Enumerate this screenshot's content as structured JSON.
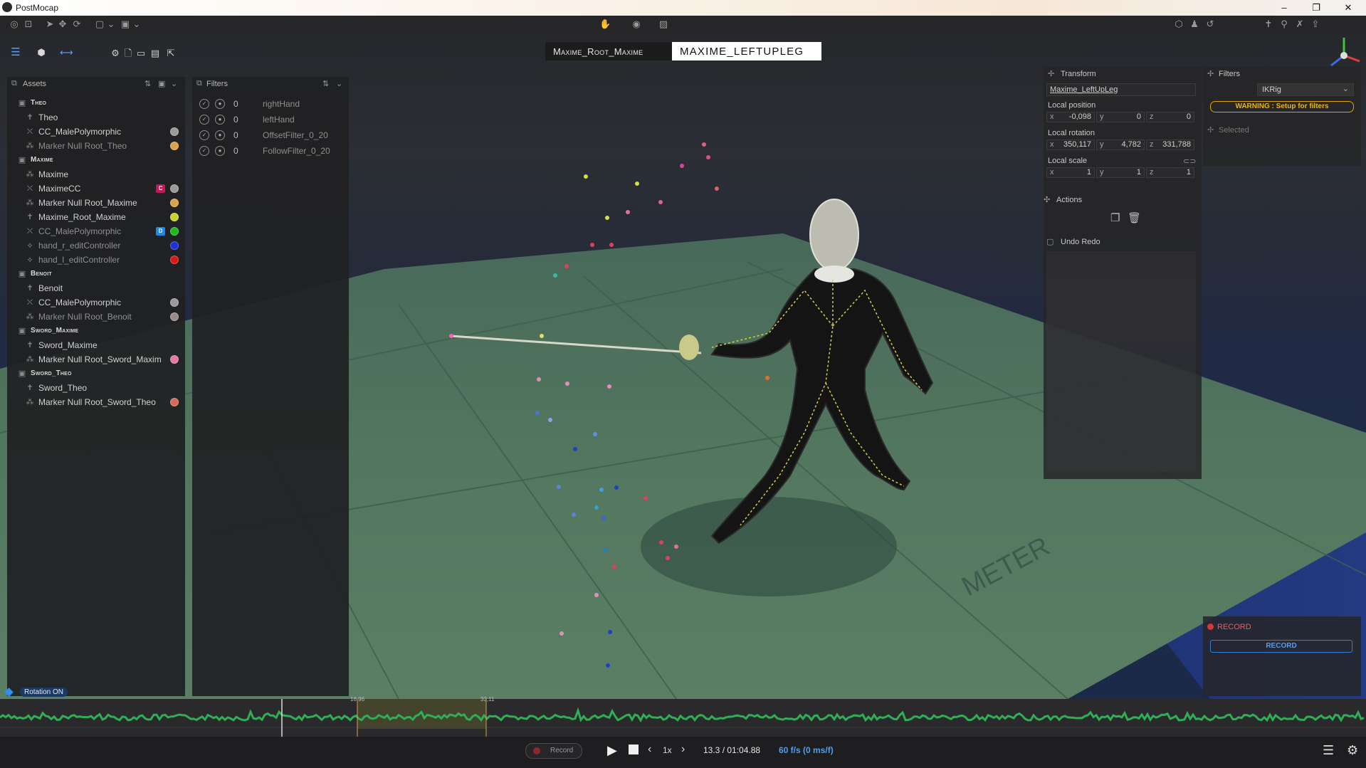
{
  "app": {
    "title": "PostMocap"
  },
  "window": {
    "minimize": "–",
    "restore": "❐",
    "close": "✕"
  },
  "toolbar": {
    "icons": [
      "select-icon",
      "move-icon",
      "rotate-icon",
      "frame-icon",
      "layout-icon",
      "hand-icon",
      "eye-icon",
      "image-icon",
      "paint-icon",
      "figure-icon",
      "undo-icon"
    ]
  },
  "tabs": [
    {
      "label": "Maxime_Root_Maxime",
      "active": false
    },
    {
      "label": "MAXIME_LEFTUPLEG",
      "active": true
    }
  ],
  "assets": {
    "header": "Assets",
    "groups": [
      {
        "name": "Theo",
        "items": [
          {
            "label": "Theo",
            "icon": "skeleton-icon",
            "dim": false
          },
          {
            "label": "CC_MalePolymorphic",
            "icon": "mesh-icon",
            "dot": "#9a9a9a",
            "dim": false
          },
          {
            "label": "Marker Null Root_Theo",
            "icon": "markers-icon",
            "dot": "#d9a34a",
            "dim": true
          }
        ]
      },
      {
        "name": "Maxime",
        "items": [
          {
            "label": "Maxime",
            "icon": "markers-icon",
            "dim": false
          },
          {
            "label": "MaximeCC",
            "icon": "mesh-icon",
            "badge": "C",
            "badge_color": "#c2185b",
            "dot": "#9a9a9a",
            "dim": false
          },
          {
            "label": "Marker Null Root_Maxime",
            "icon": "markers-icon",
            "dot": "#d9a34a",
            "dim": false
          },
          {
            "label": "Maxime_Root_Maxime",
            "icon": "skeleton-icon",
            "dot": "#c6d32e",
            "dim": false
          },
          {
            "label": "CC_MalePolymorphic",
            "icon": "mesh-icon",
            "badge": "D",
            "badge_color": "#1e88e5",
            "dot": "#21b521",
            "dim": true
          },
          {
            "label": "hand_r_editController",
            "icon": "controller-icon",
            "dot": "#1a33d6",
            "dim": true
          },
          {
            "label": "hand_l_editController",
            "icon": "controller-icon",
            "dot": "#d61a1a",
            "dim": true
          }
        ]
      },
      {
        "name": "Benoit",
        "items": [
          {
            "label": "Benoit",
            "icon": "skeleton-icon",
            "dim": false
          },
          {
            "label": "CC_MalePolymorphic",
            "icon": "mesh-icon",
            "dot": "#9a9a9a",
            "dim": false
          },
          {
            "label": "Marker Null Root_Benoit",
            "icon": "markers-icon",
            "dot": "#9a8a8a",
            "dim": true
          }
        ]
      },
      {
        "name": "Sword_Maxime",
        "items": [
          {
            "label": "Sword_Maxime",
            "icon": "skeleton-icon",
            "dim": false
          },
          {
            "label": "Marker Null Root_Sword_Maxim",
            "icon": "markers-icon",
            "dot": "#e07aa0",
            "dim": false
          }
        ]
      },
      {
        "name": "Sword_Theo",
        "items": [
          {
            "label": "Sword_Theo",
            "icon": "skeleton-icon",
            "dim": false
          },
          {
            "label": "Marker Null Root_Sword_Theo",
            "icon": "markers-icon",
            "dot": "#d46a5a",
            "dim": false
          }
        ]
      }
    ]
  },
  "filters_panel": {
    "header": "Filters",
    "rows": [
      {
        "num": "0",
        "name": "rightHand"
      },
      {
        "num": "0",
        "name": "leftHand"
      },
      {
        "num": "0",
        "name": "OffsetFilter_0_20"
      },
      {
        "num": "0",
        "name": "FollowFilter_0_20"
      }
    ]
  },
  "transform": {
    "header": "Transform",
    "name_value": "Maxime_LeftUpLeg",
    "local_position": {
      "label": "Local position",
      "x": "-0,098",
      "y": "0",
      "z": "0"
    },
    "local_rotation": {
      "label": "Local rotation",
      "x": "350,117",
      "y": "4,782",
      "z": "331,788"
    },
    "local_scale": {
      "label": "Local scale",
      "x": "1",
      "y": "1",
      "z": "1"
    },
    "axes": {
      "x": "x",
      "y": "y",
      "z": "z"
    }
  },
  "actions": {
    "header": "Actions"
  },
  "undo_redo": {
    "header": "Undo Redo"
  },
  "right_filters": {
    "header": "Filters",
    "select_value": "IKRig",
    "warning": "WARNING : Setup for filters",
    "selected_label": "Selected"
  },
  "record_panel": {
    "label": "RECORD",
    "button": "RECORD"
  },
  "viewport": {
    "rotation_badge": "Rotation ON"
  },
  "timeline": {
    "marker_a": "18,96",
    "marker_b": "33,11"
  },
  "playback": {
    "record_label": "Record",
    "speed": "1x",
    "time": "13.3 / 01:04.88",
    "fps": "60 f/s (0 ms/f)"
  },
  "colors": {
    "accent": "#2f7fd8",
    "warning": "#e0a400",
    "record": "#d03a3a"
  }
}
